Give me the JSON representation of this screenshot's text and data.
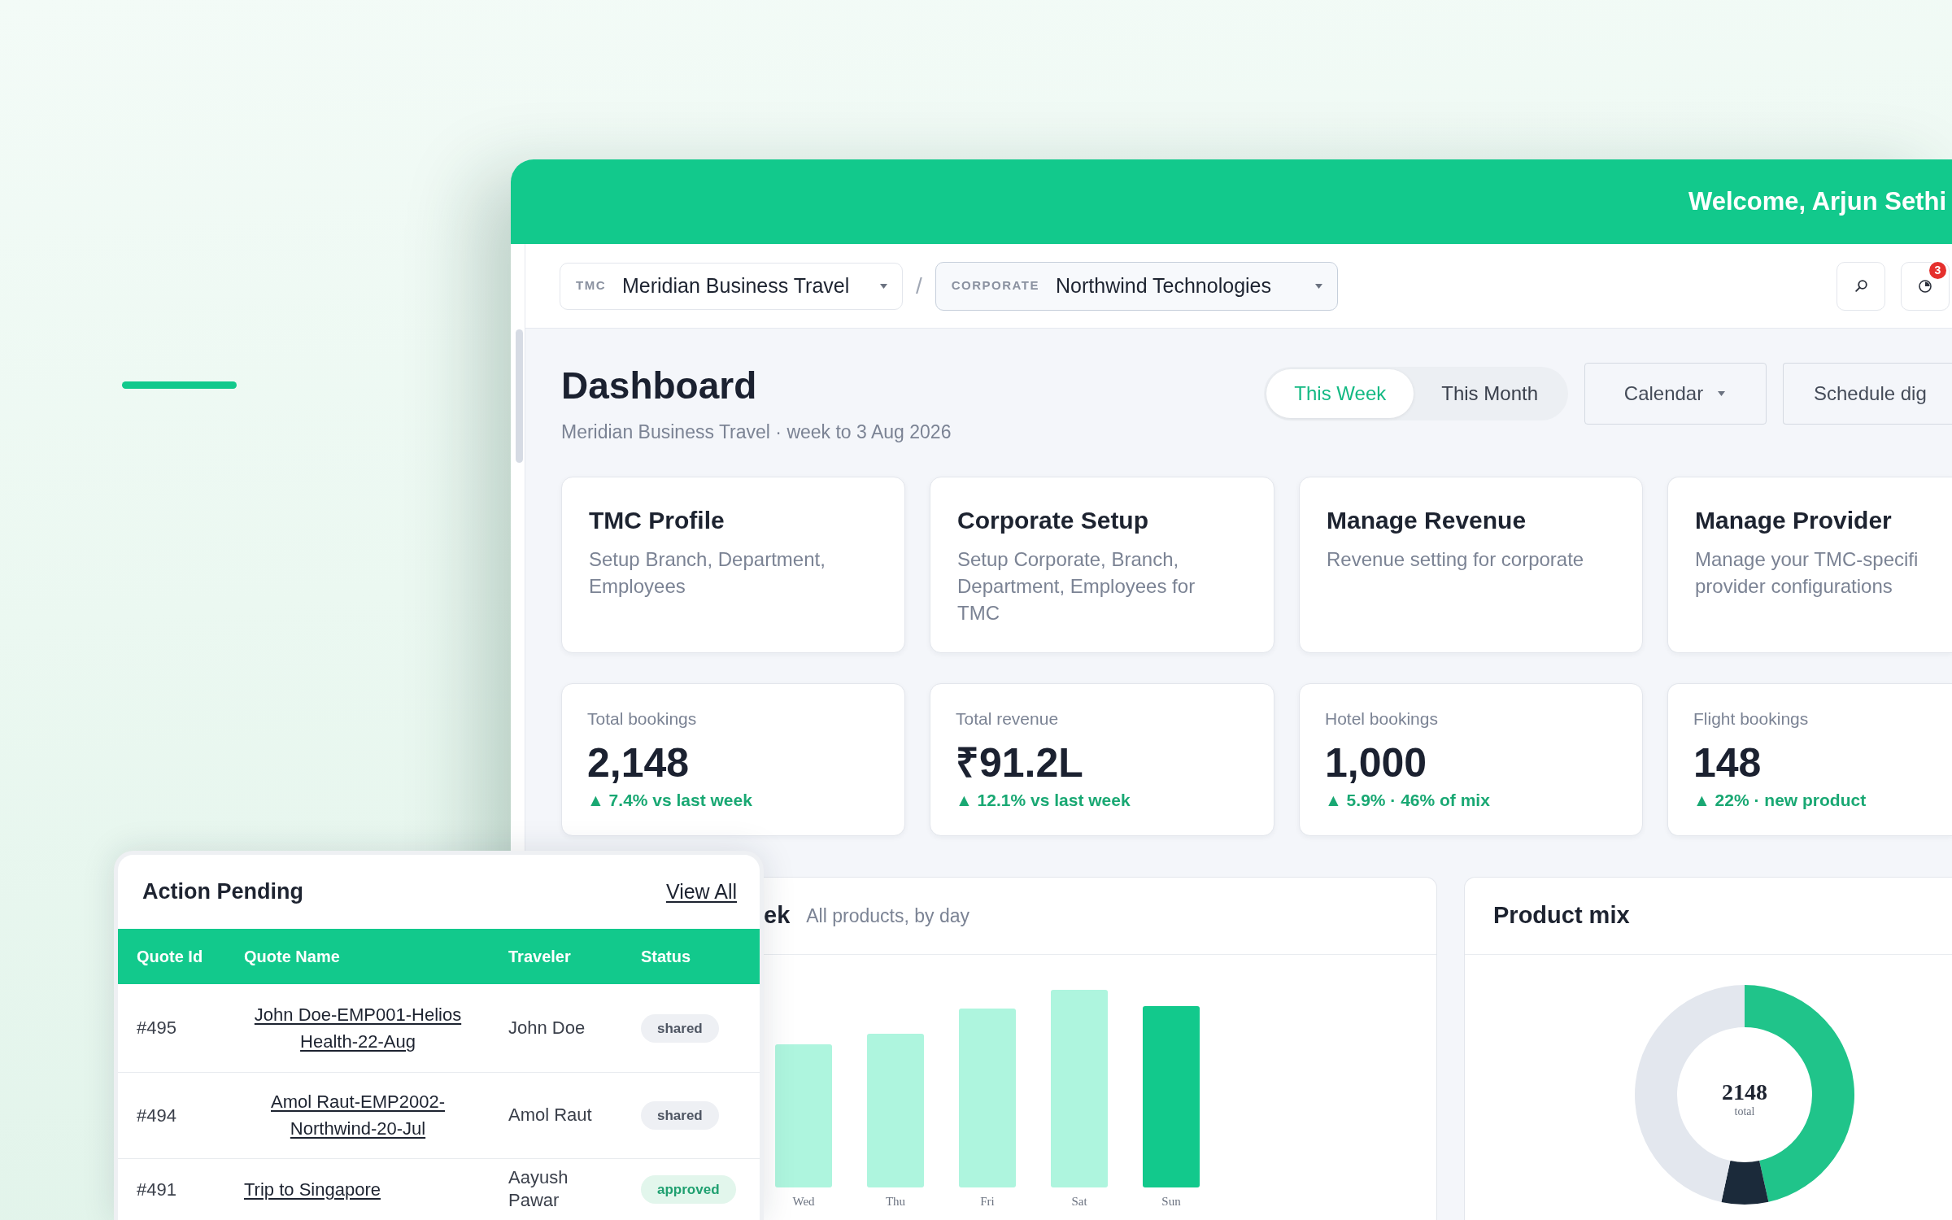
{
  "header": {
    "welcome": "Welcome, Arjun Sethi"
  },
  "toolbar": {
    "scopes": [
      {
        "label": "TMC",
        "value": "Meridian Business Travel",
        "selected": false
      },
      {
        "label": "CORPORATE",
        "value": "Northwind Technologies",
        "selected": true
      }
    ],
    "separator": "/",
    "notification_count": "3"
  },
  "dashboard": {
    "title": "Dashboard",
    "subtitle": "Meridian Business Travel · week to 3 Aug 2026",
    "periods": [
      {
        "label": "This Week",
        "selected": true
      },
      {
        "label": "This Month",
        "selected": false
      }
    ],
    "buttons": [
      {
        "label": "Calendar",
        "kind": "dropdown"
      },
      {
        "label": "Schedule dig",
        "kind": "plain"
      }
    ]
  },
  "action_cards": [
    {
      "title": "TMC Profile",
      "description": "Setup Branch, Department, Employees"
    },
    {
      "title": "Corporate Setup",
      "description": "Setup Corporate, Branch, Department, Employees for TMC"
    },
    {
      "title": "Manage Revenue",
      "description": "Revenue setting for corporate"
    },
    {
      "title": "Manage Provider",
      "description": "Manage your TMC-specifi provider configurations"
    }
  ],
  "kpis": [
    {
      "label": "Total bookings",
      "value": "2,148",
      "delta": "▲ 7.4% vs last week"
    },
    {
      "label": "Total revenue",
      "value": "₹91.2L",
      "delta": "▲ 12.1% vs last week"
    },
    {
      "label": "Hotel bookings",
      "value": "1,000",
      "delta": "▲ 5.9% · 46% of mix"
    },
    {
      "label": "Flight bookings",
      "value": "148",
      "delta": "▲ 22% · new product"
    }
  ],
  "trend_chart": {
    "title": "ek",
    "subtitle": "All products, by day",
    "bars": [
      {
        "label": "Wed",
        "highlighted": false
      },
      {
        "label": "Thu",
        "highlighted": false
      },
      {
        "label": "Fri",
        "highlighted": false
      },
      {
        "label": "Sat",
        "highlighted": false
      },
      {
        "label": "Sun",
        "highlighted": true
      }
    ]
  },
  "product_mix": {
    "title": "Product mix",
    "center_value": "2148",
    "center_label": "total"
  },
  "action_pending": {
    "title": "Action Pending",
    "link": "View All",
    "columns": [
      "Quote Id",
      "Quote Name",
      "Traveler",
      "Status"
    ],
    "rows": [
      {
        "quote_id": "#495",
        "quote_name": "John Doe-EMP001-Helios Health-22-Aug",
        "traveler": "John Doe",
        "status": {
          "label": "shared",
          "kind": "neutral"
        }
      },
      {
        "quote_id": "#494",
        "quote_name": "Amol Raut-EMP2002-Northwind-20-Jul",
        "traveler": "Amol Raut",
        "status": {
          "label": "shared",
          "kind": "neutral"
        }
      },
      {
        "quote_id": "#491",
        "quote_name": "Trip to Singapore",
        "traveler": "Aayush Pawar",
        "status": {
          "label": "approved",
          "kind": "success"
        }
      }
    ]
  }
}
